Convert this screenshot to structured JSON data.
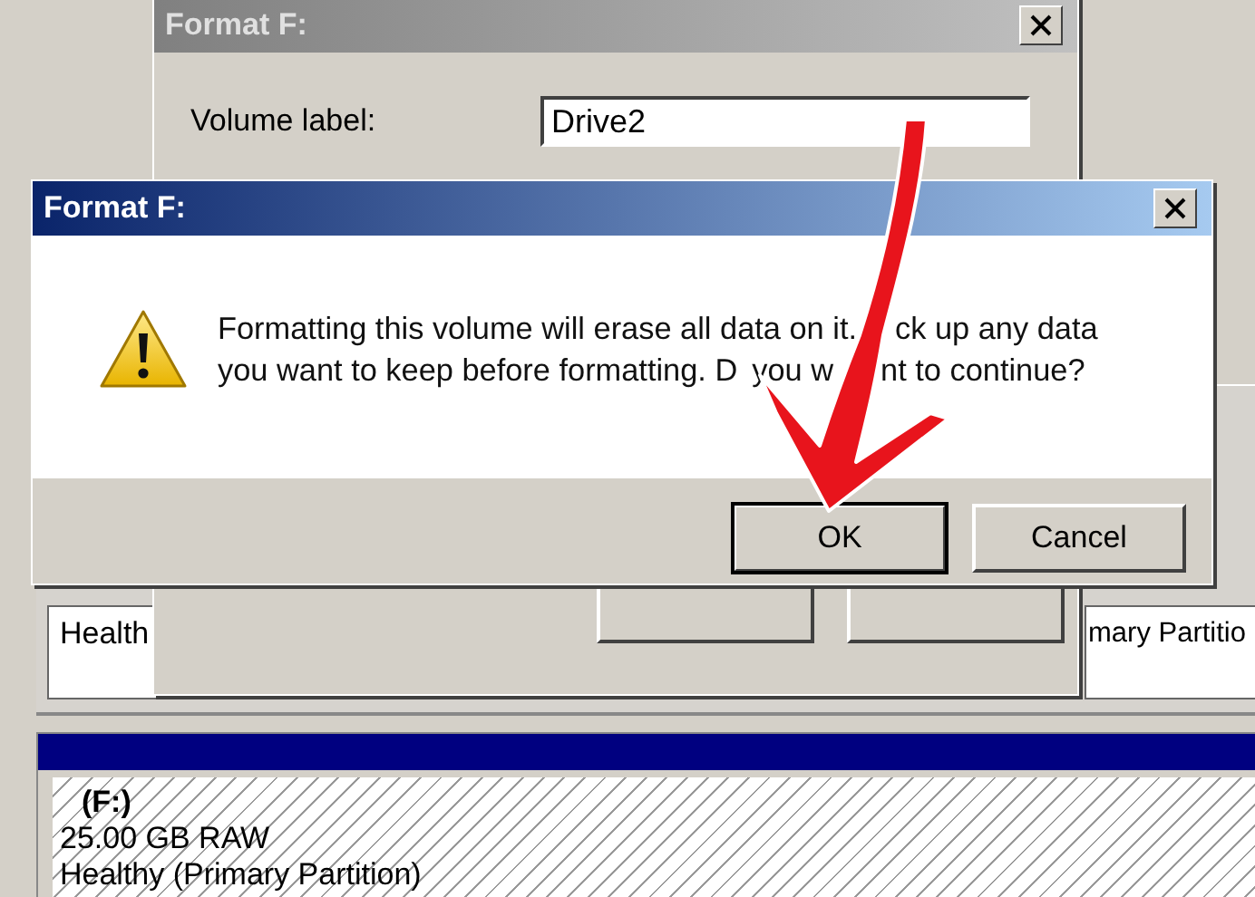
{
  "background_window": {
    "volume_tiles": [
      {
        "text": "Health"
      },
      {
        "text": "mary Partitio"
      }
    ],
    "disk_volume": {
      "name": "(F:)",
      "size": "25.00 GB RAW",
      "status": "Healthy (Primary Partition)"
    }
  },
  "format_dialog": {
    "title": "Format F:",
    "active": false,
    "volume_label": {
      "label": "Volume label:",
      "value": "Drive2"
    }
  },
  "confirm_dialog": {
    "title": "Format F:",
    "active": true,
    "message_lines": [
      [
        "Formatting this volume will erase all data on it.",
        "ck up any data"
      ],
      [
        "you want to keep before formatting. D",
        "you w",
        "nt to continue?"
      ]
    ],
    "buttons": [
      {
        "label": "OK",
        "default": true
      },
      {
        "label": "Cancel",
        "default": false
      }
    ]
  }
}
